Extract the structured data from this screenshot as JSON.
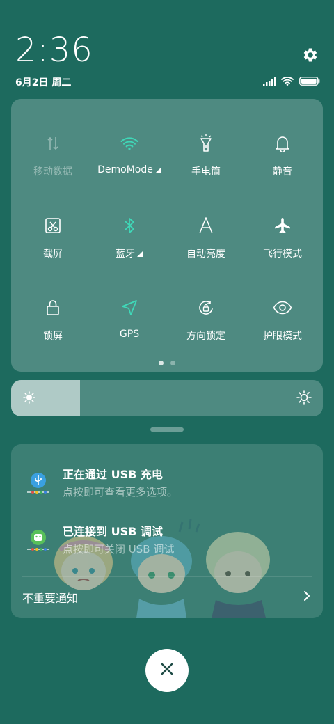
{
  "status": {
    "time": "2:36",
    "date": "6月2日 周二"
  },
  "quick_settings": {
    "tiles": [
      {
        "label": "移动数据",
        "icon": "mobile-data-icon",
        "state": "disabled"
      },
      {
        "label": "DemoMode",
        "icon": "wifi-icon",
        "state": "active",
        "has_menu": true
      },
      {
        "label": "手电筒",
        "icon": "flashlight-icon",
        "state": "off"
      },
      {
        "label": "静音",
        "icon": "bell-icon",
        "state": "off"
      },
      {
        "label": "截屏",
        "icon": "screenshot-icon",
        "state": "off"
      },
      {
        "label": "蓝牙",
        "icon": "bluetooth-icon",
        "state": "active",
        "has_menu": true
      },
      {
        "label": "自动亮度",
        "icon": "auto-brightness-icon",
        "state": "off"
      },
      {
        "label": "飞行模式",
        "icon": "airplane-icon",
        "state": "off"
      },
      {
        "label": "锁屏",
        "icon": "lock-icon",
        "state": "off"
      },
      {
        "label": "GPS",
        "icon": "gps-icon",
        "state": "active"
      },
      {
        "label": "方向锁定",
        "icon": "rotation-lock-icon",
        "state": "off"
      },
      {
        "label": "护眼模式",
        "icon": "eye-icon",
        "state": "off"
      }
    ],
    "page_count": 2,
    "current_page": 1,
    "accent_color": "#3fd8b8"
  },
  "brightness": {
    "level_fraction": 0.22
  },
  "notifications": [
    {
      "title": "正在通过 USB 充电",
      "subtitle": "点按即可查看更多选项。",
      "icon": "usb-icon"
    },
    {
      "title": "已连接到 USB 调试",
      "subtitle": "点按即可关闭 USB 调试",
      "icon": "android-debug-icon"
    }
  ],
  "minor_notifications": {
    "label": "不重要通知"
  }
}
